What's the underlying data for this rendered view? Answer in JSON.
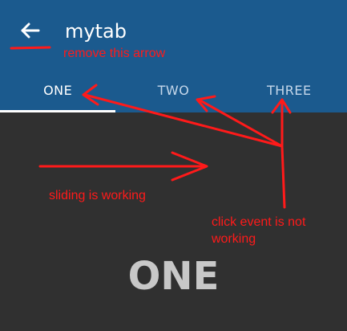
{
  "appbar": {
    "title": "mytab",
    "back_icon": "arrow-left-icon",
    "color": "#1b5a8e"
  },
  "tabs": [
    {
      "label": "ONE",
      "active": true
    },
    {
      "label": "TWO",
      "active": false
    },
    {
      "label": "THREE",
      "active": false
    }
  ],
  "content": {
    "page_label": "ONE",
    "background": "#303030"
  },
  "annotations": {
    "remove_arrow": "remove this arrow",
    "sliding": "sliding is working",
    "click_line1": "click event is not",
    "click_line2": "working",
    "color": "#ff1a1a"
  }
}
